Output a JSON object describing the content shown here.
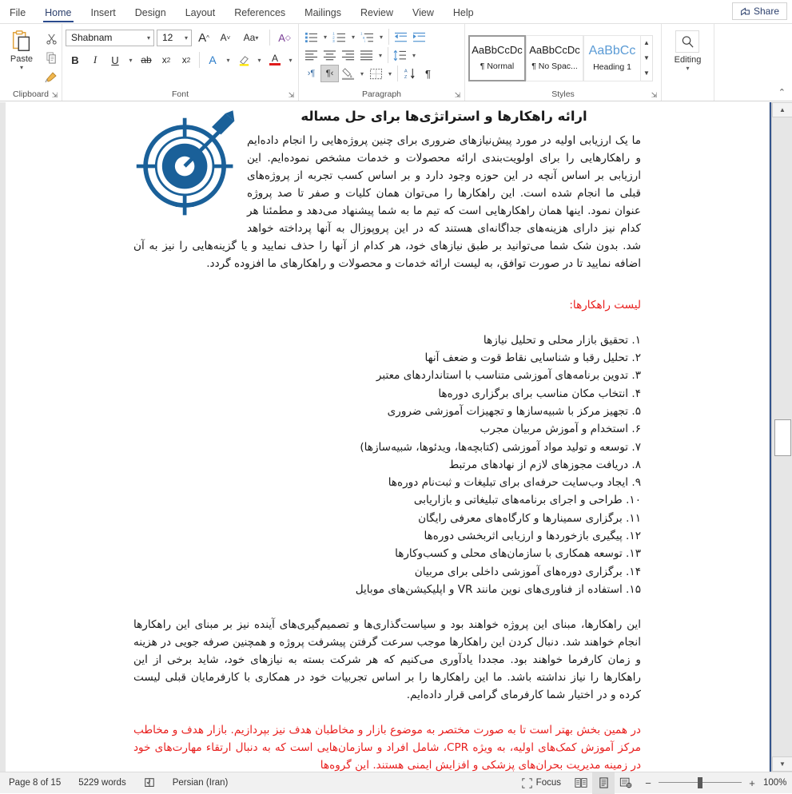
{
  "tabs": [
    {
      "label": "File",
      "active": false
    },
    {
      "label": "Home",
      "active": true
    },
    {
      "label": "Insert",
      "active": false
    },
    {
      "label": "Design",
      "active": false
    },
    {
      "label": "Layout",
      "active": false
    },
    {
      "label": "References",
      "active": false
    },
    {
      "label": "Mailings",
      "active": false
    },
    {
      "label": "Review",
      "active": false
    },
    {
      "label": "View",
      "active": false
    },
    {
      "label": "Help",
      "active": false
    }
  ],
  "share": {
    "label": "Share"
  },
  "ribbon": {
    "clipboard": {
      "label": "Clipboard",
      "paste_label": "Paste",
      "cut_name": "cut-icon",
      "copy_name": "copy-icon",
      "format_painter_name": "format-painter-icon"
    },
    "font": {
      "label": "Font",
      "font_name": "Shabnam",
      "font_size": "12",
      "grow_label": "A",
      "shrink_label": "A",
      "change_case_label": "Aa",
      "clear_format_label": "A",
      "bold_label": "B",
      "italic_label": "I",
      "underline_label": "U",
      "strikethrough_label": "ab",
      "subscript_label": "x",
      "superscript_label": "x",
      "text_effects_label": "A",
      "highlight_label": "A",
      "fontcolor_label": "A"
    },
    "paragraph": {
      "label": "Paragraph",
      "bullets_name": "bullets-icon",
      "numbering_name": "numbering-icon",
      "multilevel_name": "multilevel-list-icon",
      "decrease_indent_name": "decrease-indent-icon",
      "increase_indent_name": "increase-indent-icon",
      "align_left_name": "align-left-icon",
      "align_center_name": "align-center-icon",
      "align_right_name": "align-right-icon",
      "justify_name": "justify-icon",
      "line_spacing_name": "line-spacing-icon",
      "ltr_label": "›¶",
      "rtl_label": "¶‹",
      "shading_name": "shading-icon",
      "borders_name": "borders-icon",
      "sort_label": "A\nZ",
      "show_marks_label": "¶"
    },
    "styles": {
      "label": "Styles",
      "items": [
        {
          "sample": "AaBbCcDc",
          "name": "¶ Normal",
          "selected": true,
          "heading": false
        },
        {
          "sample": "AaBbCcDc",
          "name": "¶ No Spac...",
          "selected": false,
          "heading": false
        },
        {
          "sample": "AaBbCс",
          "name": "Heading 1",
          "selected": false,
          "heading": true
        }
      ]
    },
    "editing": {
      "label": "Editing",
      "icon_name": "search-icon"
    },
    "collapse_label": "⌃"
  },
  "document": {
    "title": "ارائه راهکارها و استراتژی‌ها برای حل مساله",
    "intro_paragraph": "ما یک ارزیابی اولیه در مورد پیش‌نیازهای ضروری برای چنین پروژه‌هایی را انجام داده‌ایم و راهکارهایی را برای اولویت‌بندی ارائه محصولات و خدمات مشخص نموده‌ایم. این ارزیابی بر اساس آنچه در این حوزه وجود دارد و بر اساس کسب تجربه از پروژه‌های قبلی ما انجام شده است. این راهکارها را می‌توان همان کلیات و صفر تا صد پروژه عنوان نمود. اینها همان راهکارهایی است که تیم ما به شما پیشنهاد می‌دهد و مطمئنا هر کدام نیز دارای هزینه‌های جداگانه‌ای هستند که در این پروپوزال به آنها پرداخته خواهد شد. بدون شک شما می‌توانید بر طبق نیازهای خود، هر کدام از آنها را حذف نمایید و یا گزینه‌هایی را نیز به آن اضافه نمایید تا در صورت توافق، به لیست ارائه خدمات و محصولات و راهکارهای ما افزوده گردد.",
    "list_heading": "لیست راهکارها:",
    "list_items": [
      "۱. تحقیق بازار محلی و تحلیل نیازها",
      "۲. تحلیل رقبا و شناسایی نقاط قوت و ضعف آنها",
      "۳. تدوین برنامه‌های آموزشی متناسب با استانداردهای معتبر",
      "۴. انتخاب مکان مناسب برای برگزاری دوره‌ها",
      "۵. تجهیز مرکز با شبیه‌سازها و تجهیزات آموزشی ضروری",
      "۶. استخدام و آموزش مربیان مجرب",
      "۷. توسعه و تولید مواد آموزشی (کتابچه‌ها، ویدئوها، شبیه‌سازها)",
      "۸. دریافت مجوزهای لازم از نهادهای مرتبط",
      "۹. ایجاد وب‌سایت حرفه‌ای برای تبلیغات و ثبت‌نام دوره‌ها",
      "۱۰. طراحی و اجرای برنامه‌های تبلیغاتی و بازاریابی",
      "۱۱. برگزاری سمینارها و کارگاه‌های معرفی رایگان",
      "۱۲. پیگیری بازخوردها و ارزیابی اثربخشی دوره‌ها",
      "۱۳. توسعه همکاری با سازمان‌های محلی و کسب‌وکارها",
      "۱۴. برگزاری دوره‌های آموزشی داخلی برای مربیان",
      "۱۵. استفاده از فناوری‌های نوین مانند VR و اپلیکیشن‌های موبایل"
    ],
    "closing_paragraph": "این راهکارها، مبنای این پروژه خواهند بود و سیاست‌گذاری‌ها و تصمیم‌گیری‌های آینده نیز بر مبنای این راهکارها انجام خواهند شد. دنبال کردن این راهکارها موجب سرعت گرفتن پیشرفت پروژه و همچنین صرفه جویی در هزینه و زمان کارفرما خواهند بود. مجددا یادآوری می‌کنیم که هر شرکت بسته به نیازهای خود، شاید برخی از این راهکارها را نیاز نداشته باشد. ما این راهکارها را بر اساس تجربیات خود در همکاری با کارفرمایان قبلی لیست کرده و در اختیار شما کارفرمای گرامی قرار داده‌ایم.",
    "red_paragraph": "در همین بخش بهتر است تا به صورت مختصر به موضوع بازار و مخاطبان هدف نیز بپردازیم. بازار هدف و مخاطب مرکز آموزش کمک‌های اولیه، به ویژه CPR، شامل افراد و سازمان‌هایی است که به دنبال ارتقاء مهارت‌های خود در زمینه مدیریت بحران‌های پزشکی و افزایش ایمنی هستند. این گروه‌ها",
    "image_name": "target-with-arrow-image"
  },
  "status": {
    "page_label": "Page 8 of 15",
    "words_label": "5229 words",
    "proofing_name": "proofing-icon",
    "language_label": "Persian (Iran)",
    "focus_label": "Focus",
    "view_read_name": "read-mode-icon",
    "view_print_name": "print-layout-icon",
    "view_web_name": "web-layout-icon",
    "zoom_out_label": "−",
    "zoom_in_label": "+",
    "zoom_value": "100%"
  },
  "colors": {
    "accent_blue": "#2b4b8d",
    "red_text": "#e8201f",
    "image_blue": "#1a6099",
    "heading_blue": "#5b9bd5"
  }
}
